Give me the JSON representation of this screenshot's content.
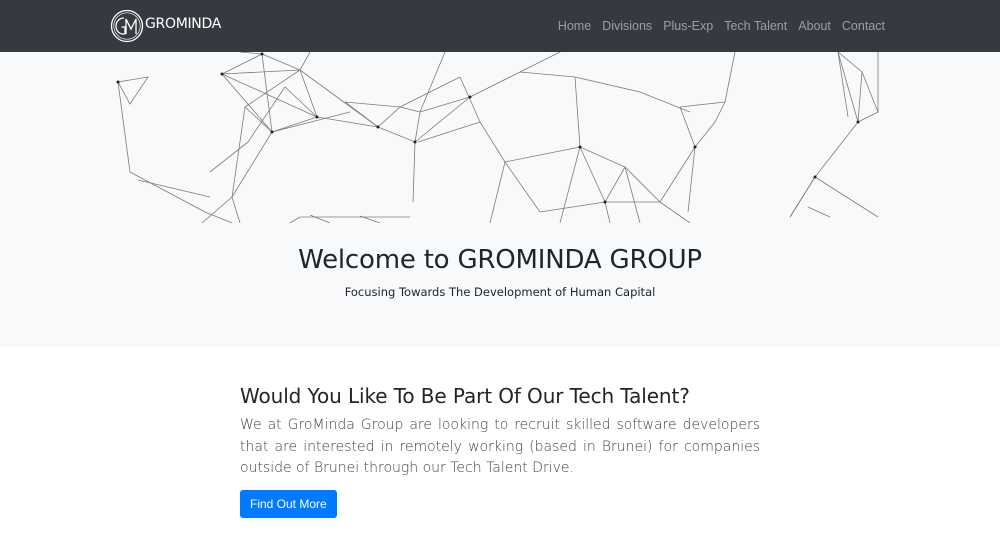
{
  "navbar": {
    "brand_name": "GROMINDA",
    "logo_monogram": "GM",
    "logo_icon": "gm-monogram-logo",
    "links": [
      {
        "label": "Home"
      },
      {
        "label": "Divisions"
      },
      {
        "label": "Plus-Exp"
      },
      {
        "label": "Tech Talent"
      },
      {
        "label": "About"
      },
      {
        "label": "Contact"
      }
    ],
    "background_color": "#343a40",
    "link_color": "rgba(255,255,255,0.5)"
  },
  "hero": {
    "title": "Welcome to GROMINDA GROUP",
    "subtitle": "Focusing Towards The Development of Human Capital",
    "background_color": "#f8f9fa",
    "decoration": "network-graph-illustration"
  },
  "tech_talent": {
    "heading": "Would You Like To Be Part Of Our Tech Talent?",
    "body": "We at GroMinda Group are looking to recruit skilled software developers that are interested in remotely working (based in Brunei) for companies outside of Brunei through our Tech Talent Drive.",
    "button_label": "Find Out More",
    "button_color": "#007bff"
  }
}
